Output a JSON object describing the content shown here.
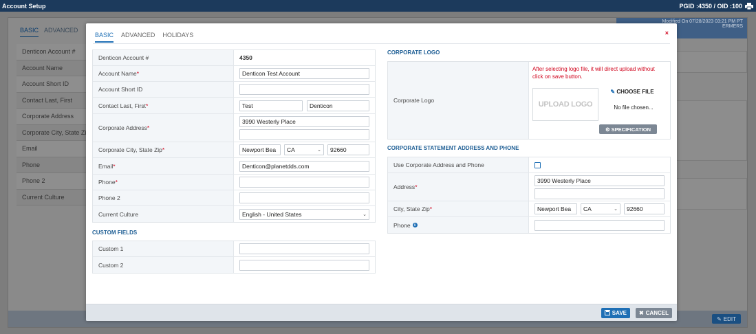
{
  "topbar": {
    "title": "Account Setup",
    "ids": "PGID :4350  /  OID :100"
  },
  "background": {
    "tabs": [
      "BASIC",
      "ADVANCED"
    ],
    "rows": [
      "Denticon Account #",
      "Account Name",
      "Account Short ID",
      "Contact Last, First",
      "Corporate Address",
      "Corporate City, State Zip",
      "Email",
      "Phone",
      "Phone 2",
      "Current Culture"
    ],
    "modified_text": "Modified On 07/28/2023 03:21 PM PT",
    "banner_sub": "ERMERS",
    "edit_label": "EDIT"
  },
  "modal": {
    "tabs": [
      {
        "label": "BASIC"
      },
      {
        "label": "ADVANCED"
      },
      {
        "label": "HOLIDAYS"
      }
    ],
    "close": "×",
    "basic": {
      "account_number": {
        "label": "Denticon Account #",
        "value": "4350"
      },
      "account_name": {
        "label": "Account Name",
        "value": "Denticon Test Account"
      },
      "short_id": {
        "label": "Account Short ID",
        "value": ""
      },
      "contact": {
        "label": "Contact Last, First",
        "last": "Test",
        "first": "Denticon"
      },
      "address": {
        "label": "Corporate Address",
        "line1": "3990 Westerly Place",
        "line2": ""
      },
      "city_state_zip": {
        "label": "Corporate City, State Zip",
        "city": "Newport Bea",
        "state": "CA",
        "zip": "92660"
      },
      "email": {
        "label": "Email",
        "value": "Denticon@planetdds.com"
      },
      "phone": {
        "label": "Phone",
        "value": ""
      },
      "phone2": {
        "label": "Phone 2",
        "value": ""
      },
      "culture": {
        "label": "Current Culture",
        "value": "English - United States"
      }
    },
    "custom_fields": {
      "title": "CUSTOM FIELDS",
      "custom1": {
        "label": "Custom 1",
        "value": ""
      },
      "custom2": {
        "label": "Custom 2",
        "value": ""
      }
    },
    "corporate_logo": {
      "title": "CORPORATE LOGO",
      "label": "Corporate Logo",
      "notice": "After selecting logo file, it will direct upload without click on save button.",
      "upload_placeholder": "UPLOAD LOGO",
      "choose_file": "CHOOSE FILE",
      "no_file": "No file chosen...",
      "spec_button": "SPECIFICATION"
    },
    "statement": {
      "title": "CORPORATE STATEMENT ADDRESS AND PHONE",
      "use_corporate": {
        "label": "Use Corporate Address and Phone",
        "checked": false
      },
      "address": {
        "label": "Address",
        "line1": "3990 Westerly Place",
        "line2": ""
      },
      "city_state_zip": {
        "label": "City, State Zip",
        "city": "Newport Bea",
        "state": "CA",
        "zip": "92660"
      },
      "phone": {
        "label": "Phone",
        "value": ""
      }
    },
    "footer": {
      "save": "SAVE",
      "cancel": "CANCEL"
    }
  },
  "colors": {
    "accent": "#1e6fb5",
    "required": "#d0021b",
    "topbar": "#1c3a5c"
  }
}
